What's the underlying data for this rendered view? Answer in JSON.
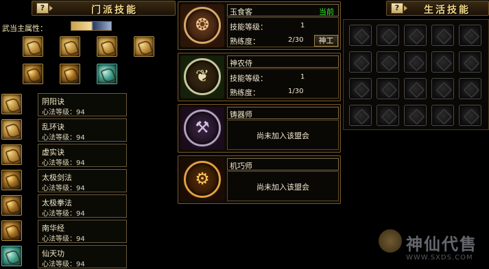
{
  "left_panel": {
    "help": "?",
    "title": "门派技能",
    "attr_label": "武当主属性：",
    "methods": [
      {
        "name": "阴阳诀",
        "level": "心法等级：94"
      },
      {
        "name": "乱环诀",
        "level": "心法等级：94"
      },
      {
        "name": "虚实诀",
        "level": "心法等级：94"
      },
      {
        "name": "太极剑法",
        "level": "心法等级：94"
      },
      {
        "name": "太极拳法",
        "level": "心法等级：94"
      },
      {
        "name": "南华经",
        "level": "心法等级：94"
      },
      {
        "name": "仙天功",
        "level": "心法等级：94"
      }
    ]
  },
  "professions": [
    {
      "name": "玉食客",
      "status": "当前",
      "skill_label": "技能等级：",
      "skill_value": "1",
      "prof_label": "熟练度：",
      "prof_value": "2/30",
      "button": "神工"
    },
    {
      "name": "神农侍",
      "skill_label": "技能等级：",
      "skill_value": "1",
      "prof_label": "熟练度：",
      "prof_value": "1/30"
    },
    {
      "name": "铸器师",
      "message": "尚未加入该盟会"
    },
    {
      "name": "机巧师",
      "message": "尚未加入该盟会"
    }
  ],
  "right_panel": {
    "help": "?",
    "title": "生活技能"
  },
  "watermark": {
    "brand": "神仙代售",
    "url": "WWW.SXDS.COM"
  }
}
